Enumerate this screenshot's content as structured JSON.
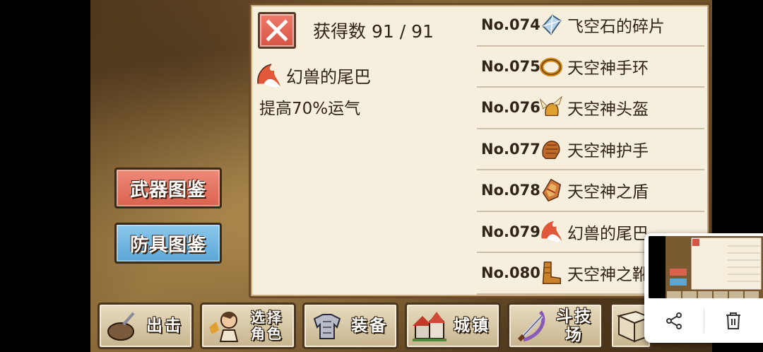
{
  "panel": {
    "count_label": "获得数 91 / 91",
    "selected": {
      "name": "幻兽的尾巴",
      "description": "提高70%运气",
      "icon": "fox-tail-icon"
    },
    "items": [
      {
        "num": "No.074",
        "name": "飞空石的碎片",
        "icon": "crystal-shard-icon"
      },
      {
        "num": "No.075",
        "name": "天空神手环",
        "icon": "bracelet-icon"
      },
      {
        "num": "No.076",
        "name": "天空神头盔",
        "icon": "winged-helmet-icon"
      },
      {
        "num": "No.077",
        "name": "天空神护手",
        "icon": "gauntlet-icon"
      },
      {
        "num": "No.078",
        "name": "天空神之盾",
        "icon": "shield-icon"
      },
      {
        "num": "No.079",
        "name": "幻兽的尾巴",
        "icon": "fox-tail-icon"
      },
      {
        "num": "No.080",
        "name": "天空神之靴",
        "icon": "boots-icon"
      }
    ]
  },
  "categories": {
    "weapon_label": "武器图鉴",
    "armor_label": "防具图鉴"
  },
  "nav": {
    "sortie": "出击",
    "select_char_line1": "选择",
    "select_char_line2": "角色",
    "equip": "装备",
    "town": "城镇",
    "arena": "斗技场"
  },
  "overlay": {
    "share_icon": "share-icon",
    "delete_icon": "trash-icon"
  },
  "colors": {
    "weapon_button": "#d9624e",
    "armor_button": "#5aa6d6",
    "close_button": "#d65444",
    "panel_bg": "#f7efde"
  }
}
